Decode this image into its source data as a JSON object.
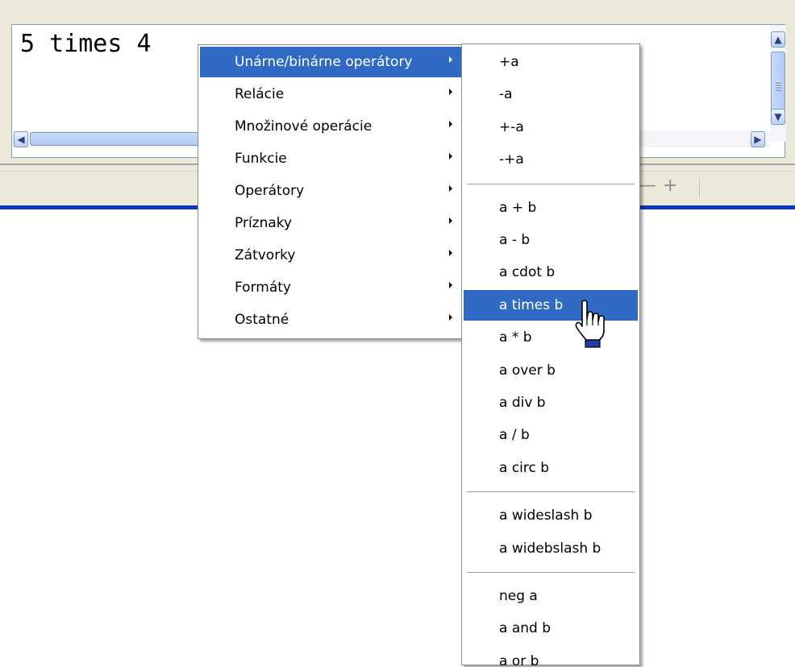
{
  "editor": {
    "text": "5 times 4"
  },
  "scrollbars": {
    "up_icon": "▲",
    "down_icon": "▼",
    "left_icon": "◀",
    "right_icon": "▶"
  },
  "toolbar": {
    "zoom_out": "—",
    "zoom_in": "+"
  },
  "main_menu": {
    "items": [
      {
        "label": "Unárne/binárne operátory",
        "active": true
      },
      {
        "label": "Relácie"
      },
      {
        "label": "Množinové operácie"
      },
      {
        "label": "Funkcie"
      },
      {
        "label": "Operátory"
      },
      {
        "label": "Príznaky"
      },
      {
        "label": "Zátvorky"
      },
      {
        "label": "Formáty"
      },
      {
        "label": "Ostatné"
      }
    ]
  },
  "sub_menu": {
    "groups": [
      [
        "+a",
        "-a",
        "+-a",
        "-+a"
      ],
      [
        "a + b",
        "a - b",
        "a cdot b",
        "a times b",
        "a * b",
        "a over b",
        "a div b",
        "a / b",
        "a circ b"
      ],
      [
        "a wideslash b",
        "a widebslash b"
      ],
      [
        "neg a",
        "a and b",
        "a or b"
      ]
    ],
    "active_item": "a times b"
  },
  "colors": {
    "highlight": "#316ac5",
    "blue_bar": "#0a37c5",
    "panel": "#ece9d8"
  },
  "icons": {
    "cursor": "hand-pointer-icon",
    "submenu_arrow": "submenu-arrow-icon"
  }
}
